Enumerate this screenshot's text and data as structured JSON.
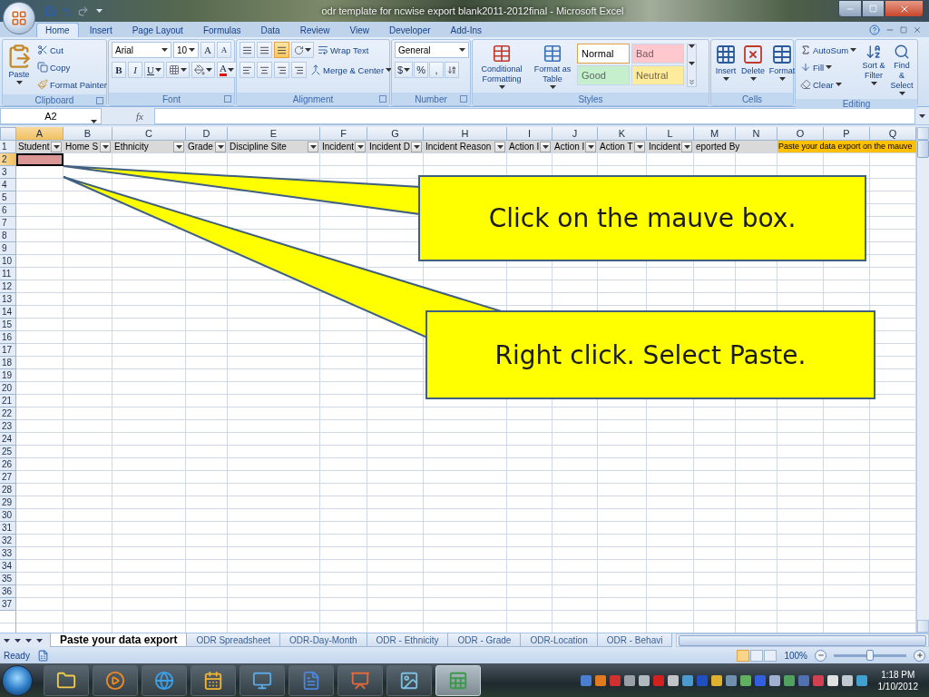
{
  "window": {
    "title": "odr template for ncwise export blank2011-2012final - Microsoft Excel"
  },
  "ribbon_tabs": [
    {
      "label": "Home",
      "selected": true
    },
    {
      "label": "Insert",
      "selected": false
    },
    {
      "label": "Page Layout",
      "selected": false
    },
    {
      "label": "Formulas",
      "selected": false
    },
    {
      "label": "Data",
      "selected": false
    },
    {
      "label": "Review",
      "selected": false
    },
    {
      "label": "View",
      "selected": false
    },
    {
      "label": "Developer",
      "selected": false
    },
    {
      "label": "Add-Ins",
      "selected": false
    }
  ],
  "ribbon": {
    "clipboard": {
      "label": "Clipboard",
      "paste": "Paste",
      "cut": "Cut",
      "copy": "Copy",
      "format_painter": "Format Painter"
    },
    "font": {
      "label": "Font",
      "font_name": "Arial",
      "font_size": "10",
      "grow": "A",
      "shrink": "A",
      "bold": "B",
      "italic": "I",
      "underline": "U",
      "font_color": "A"
    },
    "alignment": {
      "label": "Alignment",
      "vertical_buttons": [
        {
          "selected": false
        },
        {
          "selected": false
        },
        {
          "selected": true
        }
      ],
      "wrap_text": "Wrap Text",
      "merge_center": "Merge & Center"
    },
    "number": {
      "label": "Number",
      "format": "General",
      "currency": "$",
      "percent": "%",
      "comma": ","
    },
    "styles": {
      "label": "Styles",
      "conditional": "Conditional Formatting",
      "format_table": "Format as Table",
      "cell_styles": [
        {
          "label": "Normal",
          "color": "#ffffff",
          "selected": true
        },
        {
          "label": "Bad",
          "color": "#ffc7ce",
          "selected": false
        },
        {
          "label": "Good",
          "color": "#c6efce",
          "selected": false
        },
        {
          "label": "Neutral",
          "color": "#ffeb9c",
          "selected": false
        }
      ]
    },
    "cells": {
      "label": "Cells",
      "insert": "Insert",
      "delete": "Delete",
      "format": "Format"
    },
    "editing": {
      "label": "Editing",
      "autosum": "AutoSum",
      "fill": "Fill",
      "clear": "Clear",
      "sort": "Sort & Filter",
      "find": "Find & Select"
    }
  },
  "formula_bar": {
    "name_box": "A2",
    "fx": "fx"
  },
  "sheet": {
    "columns": [
      {
        "letter": "A",
        "selected": true
      },
      {
        "letter": "B",
        "selected": false
      },
      {
        "letter": "C",
        "selected": false
      },
      {
        "letter": "D",
        "selected": false
      },
      {
        "letter": "E",
        "selected": false
      },
      {
        "letter": "F",
        "selected": false
      },
      {
        "letter": "G",
        "selected": false
      },
      {
        "letter": "H",
        "selected": false
      },
      {
        "letter": "I",
        "selected": false
      },
      {
        "letter": "J",
        "selected": false
      },
      {
        "letter": "K",
        "selected": false
      },
      {
        "letter": "L",
        "selected": false
      },
      {
        "letter": "M",
        "selected": false
      },
      {
        "letter": "N",
        "selected": false
      },
      {
        "letter": "O",
        "selected": false
      },
      {
        "letter": "P",
        "selected": false
      },
      {
        "letter": "Q",
        "selected": false
      }
    ],
    "header_cells": [
      {
        "kind": "label",
        "text": "Student",
        "filter": true
      },
      {
        "kind": "label",
        "text": "Home S",
        "filter": true
      },
      {
        "kind": "label",
        "text": "Ethnicity",
        "filter": true
      },
      {
        "kind": "label",
        "text": "Grade",
        "filter": true
      },
      {
        "kind": "label",
        "text": "Discipline Site",
        "filter": true
      },
      {
        "kind": "label",
        "text": "Incident",
        "filter": true
      },
      {
        "kind": "label",
        "text": "Incident D",
        "filter": true
      },
      {
        "kind": "label",
        "text": "Incident Reason",
        "filter": true
      },
      {
        "kind": "label",
        "text": "Action I",
        "filter": true
      },
      {
        "kind": "label",
        "text": "Action I",
        "filter": true
      },
      {
        "kind": "label",
        "text": "Action T",
        "filter": true
      },
      {
        "kind": "label",
        "text": "Incident",
        "filter": true
      },
      {
        "kind": "label",
        "text": "eported By",
        "filter": false
      },
      {
        "kind": "blank"
      },
      {
        "kind": "banner",
        "text": "Paste your data export on the mauve"
      }
    ],
    "rows": [
      {
        "label": "1",
        "selected": false
      },
      {
        "label": "2",
        "selected": true
      },
      {
        "label": "3",
        "selected": false
      },
      {
        "label": "4",
        "selected": false
      },
      {
        "label": "5",
        "selected": false
      },
      {
        "label": "6",
        "selected": false
      },
      {
        "label": "7",
        "selected": false
      },
      {
        "label": "8",
        "selected": false
      },
      {
        "label": "9",
        "selected": false
      },
      {
        "label": "10",
        "selected": false
      },
      {
        "label": "11",
        "selected": false
      },
      {
        "label": "12",
        "selected": false
      },
      {
        "label": "13",
        "selected": false
      },
      {
        "label": "14",
        "selected": false
      },
      {
        "label": "15",
        "selected": false
      },
      {
        "label": "16",
        "selected": false
      },
      {
        "label": "17",
        "selected": false
      },
      {
        "label": "18",
        "selected": false
      },
      {
        "label": "19",
        "selected": false
      },
      {
        "label": "20",
        "selected": false
      },
      {
        "label": "21",
        "selected": false
      },
      {
        "label": "22",
        "selected": false
      },
      {
        "label": "23",
        "selected": false
      },
      {
        "label": "24",
        "selected": false
      },
      {
        "label": "25",
        "selected": false
      },
      {
        "label": "26",
        "selected": false
      },
      {
        "label": "27",
        "selected": false
      },
      {
        "label": "28",
        "selected": false
      },
      {
        "label": "29",
        "selected": false
      },
      {
        "label": "30",
        "selected": false
      },
      {
        "label": "31",
        "selected": false
      },
      {
        "label": "32",
        "selected": false
      },
      {
        "label": "33",
        "selected": false
      },
      {
        "label": "34",
        "selected": false
      },
      {
        "label": "35",
        "selected": false
      },
      {
        "label": "36",
        "selected": false
      },
      {
        "label": "37",
        "selected": false
      }
    ]
  },
  "callouts": [
    {
      "text": "Click on the mauve box."
    },
    {
      "text": "Right click. Select Paste."
    }
  ],
  "sheet_tabs": [
    {
      "label": "Paste your data export",
      "selected": true
    },
    {
      "label": "ODR Spreadsheet",
      "selected": false
    },
    {
      "label": "ODR-Day-Month",
      "selected": false
    },
    {
      "label": "ODR - Ethnicity",
      "selected": false
    },
    {
      "label": "ODR - Grade",
      "selected": false
    },
    {
      "label": "ODR-Location",
      "selected": false
    },
    {
      "label": "ODR - Behavi",
      "selected": false
    }
  ],
  "status_bar": {
    "status": "Ready",
    "views": [
      {
        "selected": true
      },
      {
        "selected": false
      },
      {
        "selected": false
      }
    ],
    "zoom": "100%",
    "zoom_slider": {
      "level": 0.5
    }
  },
  "taskbar": {
    "apps": [
      {
        "kind": "folder",
        "selected": false
      },
      {
        "kind": "media",
        "selected": false
      },
      {
        "kind": "browser",
        "selected": false
      },
      {
        "kind": "calendar",
        "selected": false
      },
      {
        "kind": "remote",
        "selected": false
      },
      {
        "kind": "word",
        "selected": false
      },
      {
        "kind": "slides",
        "selected": false
      },
      {
        "kind": "photo",
        "selected": false
      },
      {
        "kind": "spreadsheet",
        "selected": true
      }
    ],
    "time": "1:18 PM",
    "date": "1/10/2012"
  }
}
